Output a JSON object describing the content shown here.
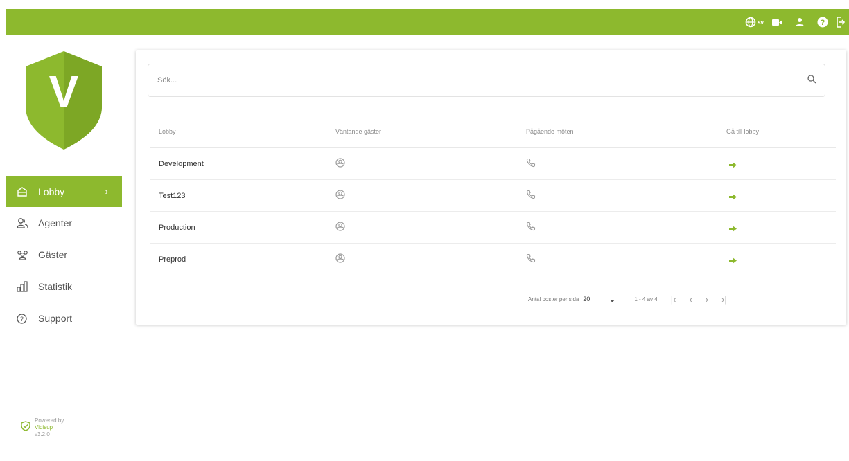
{
  "header": {
    "language": "sv",
    "icons": [
      "globe-icon",
      "video-camera-icon",
      "user-icon",
      "help-icon",
      "logout-icon"
    ]
  },
  "brand": {
    "logo_letter": "V",
    "accent": "#8db92e",
    "powered_by": "Powered by",
    "name": "Vidisup",
    "version": "v3.2.0"
  },
  "sidebar": {
    "items": [
      {
        "label": "Lobby",
        "icon": "lobby-icon",
        "active": true
      },
      {
        "label": "Agenter",
        "icon": "agents-icon"
      },
      {
        "label": "Gäster",
        "icon": "guests-icon"
      },
      {
        "label": "Statistik",
        "icon": "statistics-icon"
      },
      {
        "label": "Support",
        "icon": "support-icon"
      }
    ]
  },
  "search": {
    "placeholder": "Sök..."
  },
  "table": {
    "columns": [
      "Lobby",
      "Väntande gäster",
      "Pågående möten",
      "Gå till lobby"
    ],
    "rows": [
      {
        "name": "Development"
      },
      {
        "name": "Test123"
      },
      {
        "name": "Production"
      },
      {
        "name": "Preprod"
      }
    ]
  },
  "pagination": {
    "per_page_label": "Antal poster per sida",
    "per_page_value": "20",
    "range": "1 - 4 av 4"
  }
}
